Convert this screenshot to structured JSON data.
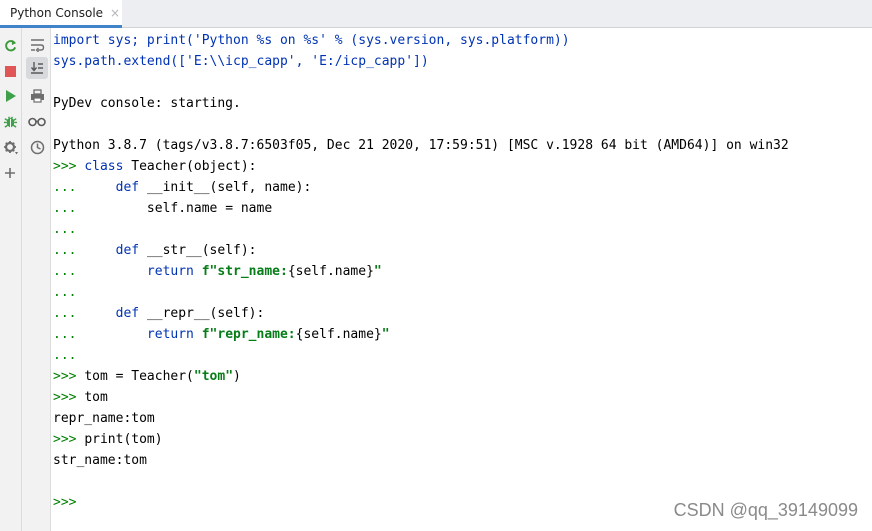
{
  "tab": {
    "title": "Python Console",
    "close_glyph": "×"
  },
  "left_toolbar": [
    {
      "name": "rerun-icon",
      "color": "#3c9a3c"
    },
    {
      "name": "stop-icon",
      "color": "#e05555"
    },
    {
      "name": "execute-icon",
      "color": "#3ea14a"
    },
    {
      "name": "debug-icon",
      "color": "#3ea14a"
    },
    {
      "name": "settings-icon",
      "color": "#6e6e6e"
    },
    {
      "name": "add-icon",
      "color": "#6e6e6e"
    }
  ],
  "second_toolbar": [
    {
      "name": "soft-wrap-icon"
    },
    {
      "name": "scroll-to-end-icon"
    },
    {
      "name": "print-icon"
    },
    {
      "name": "show-variables-icon"
    },
    {
      "name": "history-icon"
    }
  ],
  "console": {
    "lines": [
      {
        "segments": [
          {
            "t": "import sys; print('Python %s on %s' % (sys.version, sys.platform))",
            "c": "blue"
          }
        ]
      },
      {
        "segments": [
          {
            "t": "sys.path.extend(['E:\\\\icp_capp', 'E:/icp_capp'])",
            "c": "blue"
          }
        ]
      },
      {
        "segments": [
          {
            "t": "",
            "c": "plain"
          }
        ]
      },
      {
        "segments": [
          {
            "t": "PyDev console: starting.",
            "c": "plain"
          }
        ]
      },
      {
        "segments": [
          {
            "t": "",
            "c": "plain"
          }
        ]
      },
      {
        "segments": [
          {
            "t": "Python 3.8.7 (tags/v3.8.7:6503f05, Dec 21 2020, 17:59:51) [MSC v.1928 64 bit (AMD64)] on win32",
            "c": "plain"
          }
        ]
      },
      {
        "segments": [
          {
            "t": ">>> ",
            "c": "prompt"
          },
          {
            "t": "class ",
            "c": "kw"
          },
          {
            "t": "Teacher(object):",
            "c": "plain"
          }
        ]
      },
      {
        "segments": [
          {
            "t": "...     ",
            "c": "prompt"
          },
          {
            "t": "def ",
            "c": "kw"
          },
          {
            "t": "__init__(self, name):",
            "c": "plain"
          }
        ]
      },
      {
        "segments": [
          {
            "t": "...         ",
            "c": "prompt"
          },
          {
            "t": "self.name = name",
            "c": "plain"
          }
        ]
      },
      {
        "segments": [
          {
            "t": "...",
            "c": "prompt"
          }
        ]
      },
      {
        "segments": [
          {
            "t": "...     ",
            "c": "prompt"
          },
          {
            "t": "def ",
            "c": "kw"
          },
          {
            "t": "__str__(self):",
            "c": "plain"
          }
        ]
      },
      {
        "segments": [
          {
            "t": "...         ",
            "c": "prompt"
          },
          {
            "t": "return ",
            "c": "kw"
          },
          {
            "t": "f\"str_name:",
            "c": "str"
          },
          {
            "t": "{self.name}",
            "c": "plain"
          },
          {
            "t": "\"",
            "c": "str"
          }
        ]
      },
      {
        "segments": [
          {
            "t": "...",
            "c": "prompt"
          }
        ]
      },
      {
        "segments": [
          {
            "t": "...     ",
            "c": "prompt"
          },
          {
            "t": "def ",
            "c": "kw"
          },
          {
            "t": "__repr__(self):",
            "c": "plain"
          }
        ]
      },
      {
        "segments": [
          {
            "t": "...         ",
            "c": "prompt"
          },
          {
            "t": "return ",
            "c": "kw"
          },
          {
            "t": "f\"repr_name:",
            "c": "str"
          },
          {
            "t": "{self.name}",
            "c": "plain"
          },
          {
            "t": "\"",
            "c": "str"
          }
        ]
      },
      {
        "segments": [
          {
            "t": "...",
            "c": "prompt"
          }
        ]
      },
      {
        "segments": [
          {
            "t": ">>> ",
            "c": "prompt"
          },
          {
            "t": "tom = Teacher(",
            "c": "plain"
          },
          {
            "t": "\"tom\"",
            "c": "str"
          },
          {
            "t": ")",
            "c": "plain"
          }
        ]
      },
      {
        "segments": [
          {
            "t": ">>> ",
            "c": "prompt"
          },
          {
            "t": "tom",
            "c": "plain"
          }
        ]
      },
      {
        "segments": [
          {
            "t": "repr_name:tom",
            "c": "plain"
          }
        ]
      },
      {
        "segments": [
          {
            "t": ">>> ",
            "c": "prompt"
          },
          {
            "t": "print(tom)",
            "c": "plain"
          }
        ]
      },
      {
        "segments": [
          {
            "t": "str_name:tom",
            "c": "plain"
          }
        ]
      },
      {
        "segments": [
          {
            "t": "",
            "c": "plain"
          }
        ]
      },
      {
        "segments": [
          {
            "t": ">>>",
            "c": "prompt"
          }
        ]
      }
    ]
  },
  "watermark": "CSDN @qq_39149099"
}
